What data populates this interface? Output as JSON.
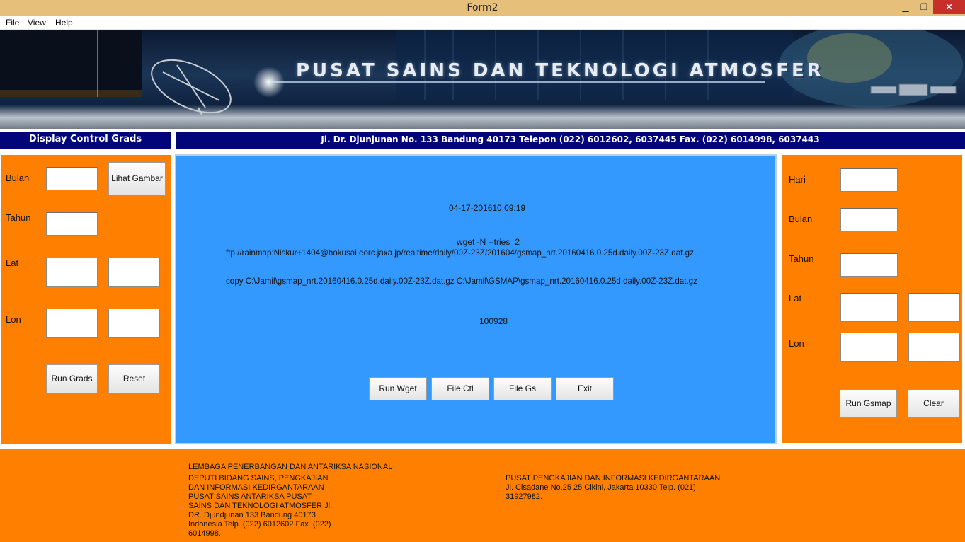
{
  "window": {
    "title": "Form2",
    "minimize_glyph": "▁",
    "maximize_glyph": "❐",
    "close_glyph": "✕"
  },
  "menu": {
    "file": "File",
    "view": "View",
    "help": "Help"
  },
  "banner": {
    "title": "PUSAT SAINS DAN TEKNOLOGI ATMOSFER"
  },
  "headers": {
    "left": "Display Control Grads",
    "center": "Jl. Dr. Djunjunan No. 133 Bandung 40173 Telepon (022) 6012602, 6037445 Fax. (022) 6014998, 6037443"
  },
  "left_panel": {
    "bulan_label": "Bulan",
    "tahun_label": "Tahun",
    "lat_label": "Lat",
    "lon_label": "Lon",
    "bulan_value": "",
    "tahun_value": "",
    "lat1_value": "",
    "lat2_value": "",
    "lon1_value": "",
    "lon2_value": "",
    "lihat_gambar": "Lihat Gambar",
    "run_grads": "Run Grads",
    "reset": "Reset"
  },
  "center_panel": {
    "datetime": "04-17-201610:09:19",
    "wget_cmd_line1": "wget -N --tries=2",
    "wget_cmd_line2": "ftp://rainmap:Niskur+1404@hokusai.eorc.jaxa.jp/realtime/daily/00Z-23Z/201604/gsmap_nrt.20160416.0.25d.daily.00Z-23Z.dat.gz",
    "copy_cmd": "copy C:\\Jamil\\gsmap_nrt.20160416.0.25d.daily.00Z-23Z.dat.gz C:\\Jamil\\GSMAP\\gsmap_nrt.20160416.0.25d.daily.00Z-23Z.dat.gz",
    "number": "100928",
    "run_wget": "Run Wget",
    "file_ctl": "File Ctl",
    "file_gs": "File Gs",
    "exit": "Exit"
  },
  "right_panel": {
    "hari_label": "Hari",
    "bulan_label": "Bulan",
    "tahun_label": "Tahun",
    "lat_label": "Lat",
    "lon_label": "Lon",
    "hari_value": "",
    "bulan_value": "",
    "tahun_value": "",
    "lat1_value": "",
    "lat2_value": "",
    "lon1_value": "",
    "lon2_value": "",
    "run_gsmap": "Run Gsmap",
    "clear": "Clear"
  },
  "footer": {
    "col1_line1": "LEMBAGA PENERBANGAN DAN ANTARIKSA NASIONAL",
    "col1_line2": "DEPUTI BIDANG SAINS, PENGKAJIAN",
    "col1_line3": "DAN INFORMASI KEDIRGANTARAAN",
    "col1_line4": "PUSAT SAINS ANTARIKSA PUSAT",
    "col1_line5": "SAINS DAN TEKNOLOGI ATMOSFER Jl.",
    "col1_line6": "DR. Djundjunan 133 Bandung 40173",
    "col1_line7": "Indonesia  Telp. (022) 6012602 Fax. (022)",
    "col1_line8": "6014998.",
    "col2_line1": "PUSAT PENGKAJIAN DAN INFORMASI KEDIRGANTARAAN",
    "col2_line2": "Jl. Cisadane No.25 25 Cikini, Jakarta 10330 Telp. (021)",
    "col2_line3": "31927982."
  }
}
